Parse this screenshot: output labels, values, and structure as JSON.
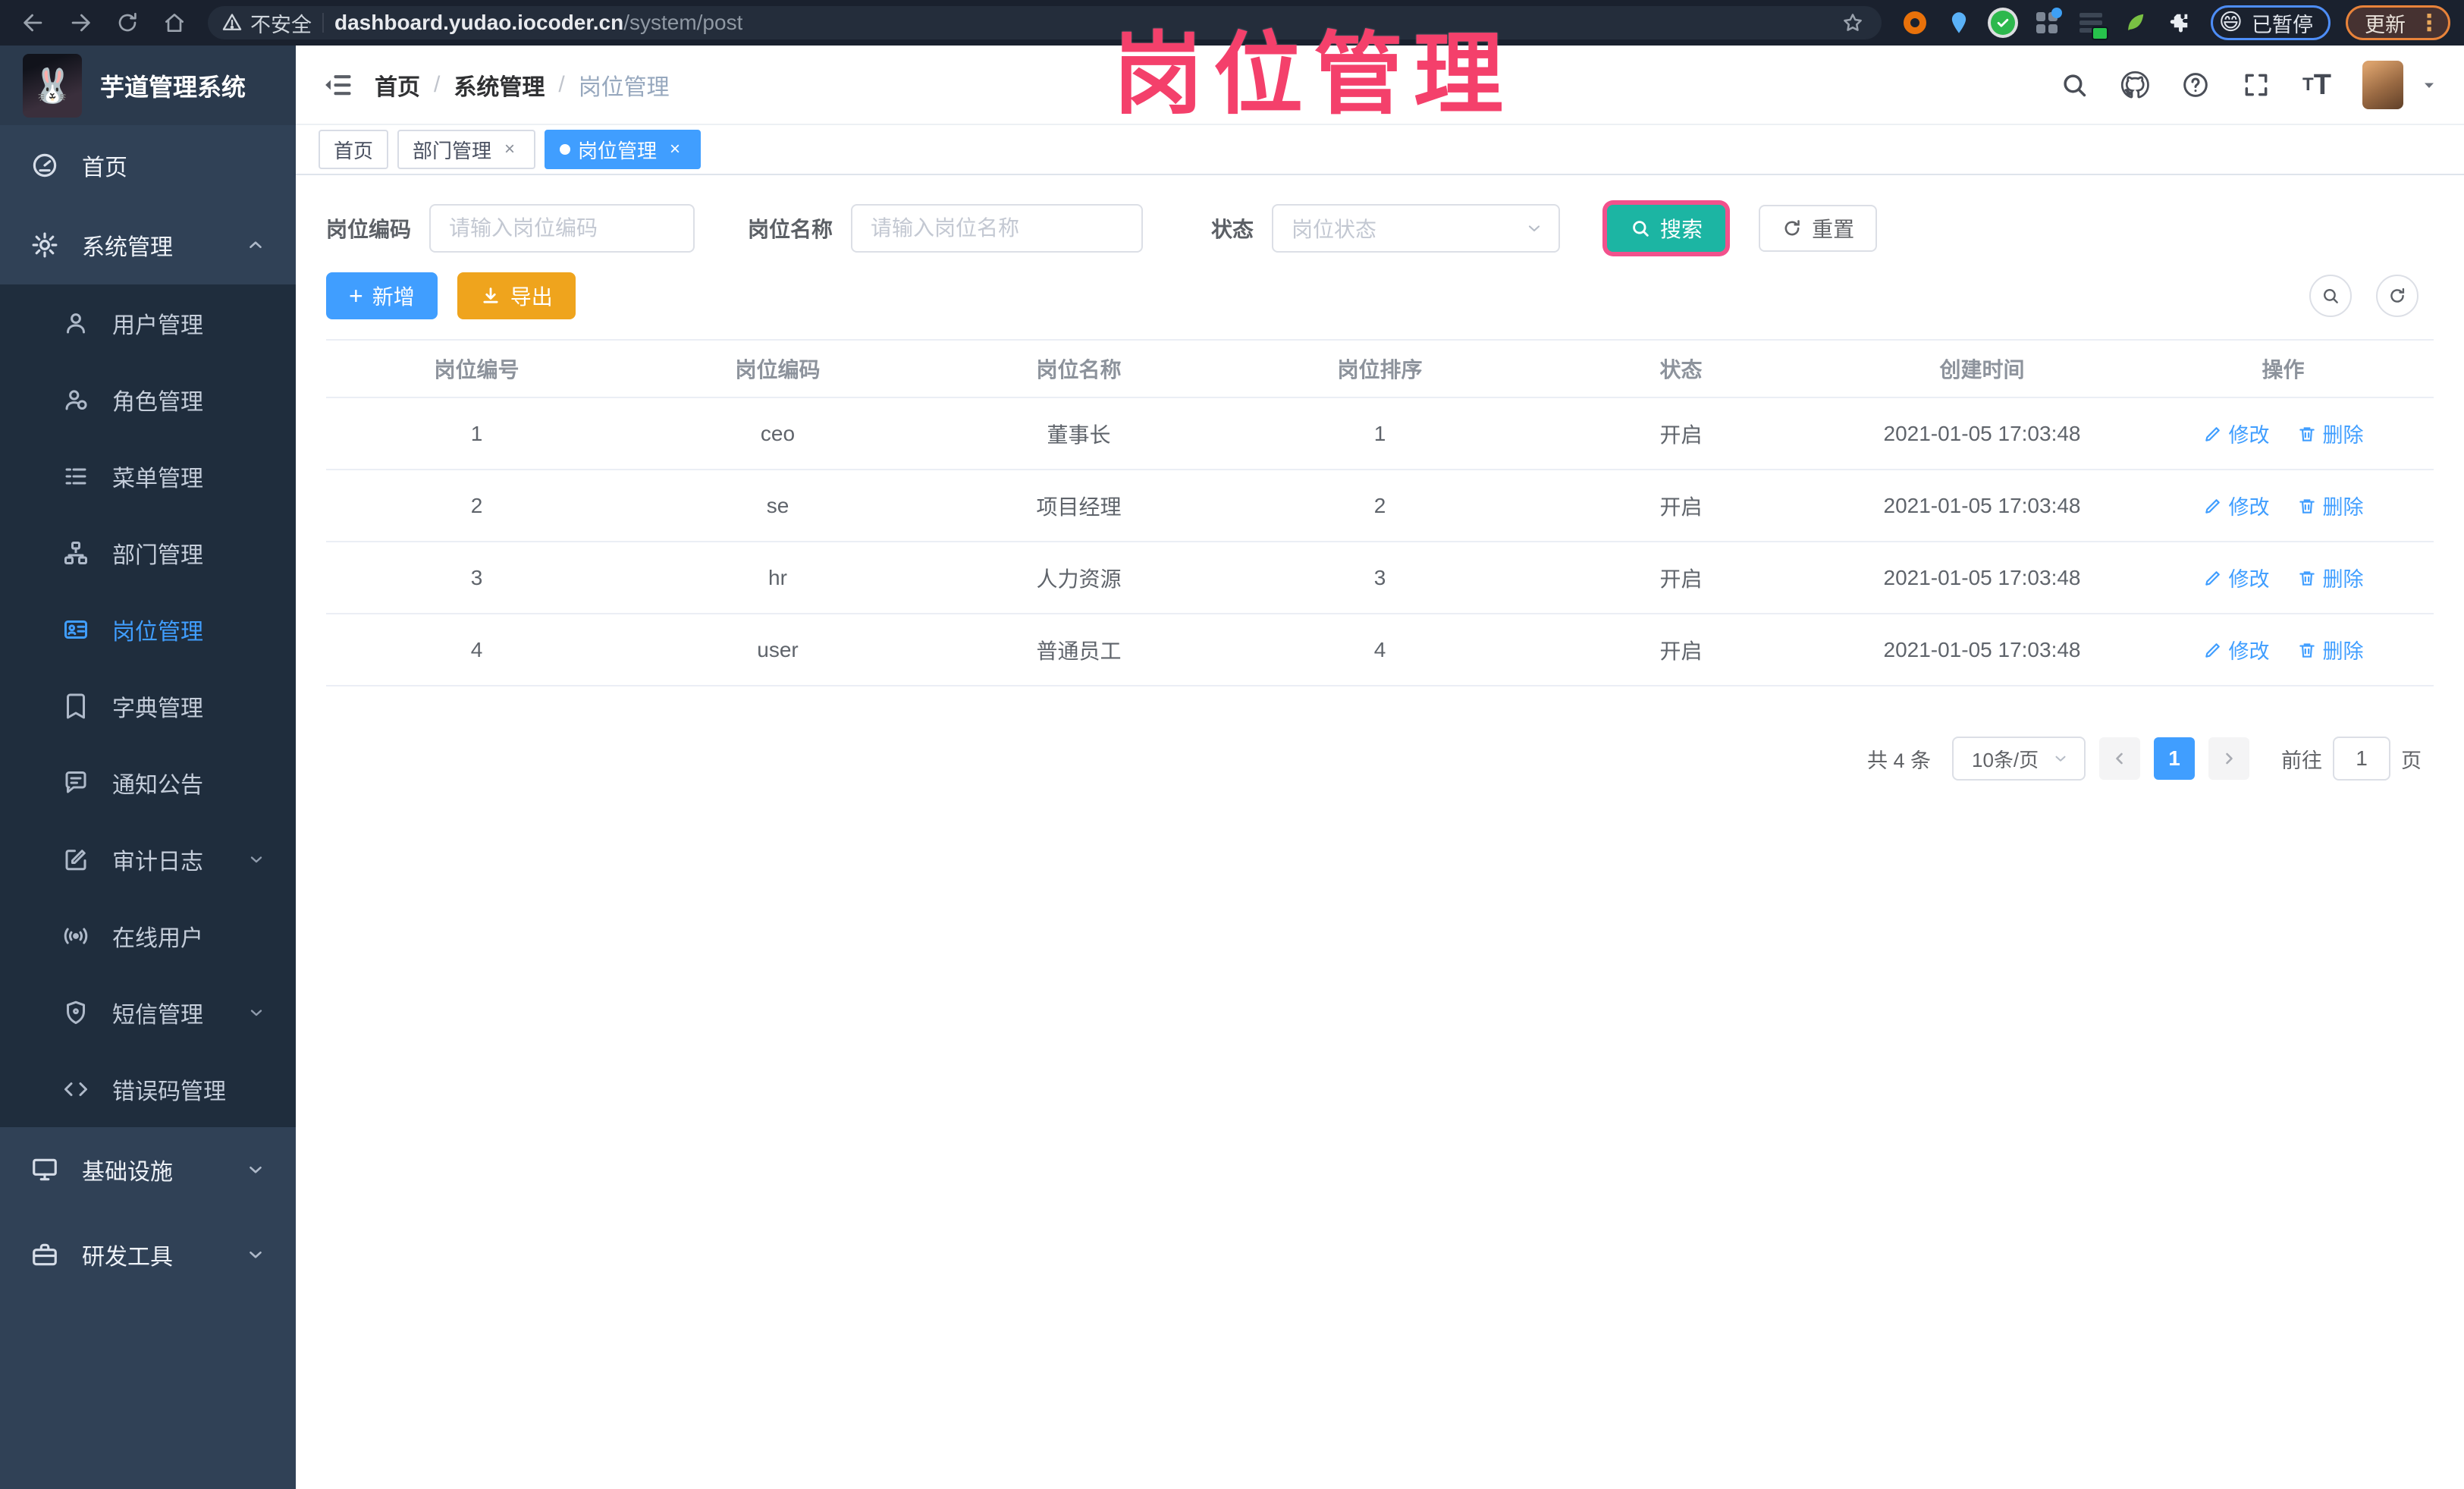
{
  "colors": {
    "accent_blue": "#409eff",
    "search_teal": "#1cb5a3",
    "export_orange": "#efa41d",
    "overlay_pink": "#f4406b",
    "sidebar_bg": "#304156",
    "submenu_bg": "#1f2d3d"
  },
  "overlay_title": "岗位管理",
  "browser": {
    "security_text": "不安全",
    "url_host": "dashboard.yudao.iocoder.cn",
    "url_path": "/system/post",
    "paused_emoji": "😄",
    "paused_label": "已暂停",
    "update_label": "更新",
    "update_menu_dots": "⋮"
  },
  "sidebar": {
    "logo_emoji": "🐰",
    "logo_title": "芋道管理系统",
    "top_items": [
      {
        "label": "首页"
      },
      {
        "label": "系统管理"
      }
    ],
    "system_children": [
      {
        "label": "用户管理"
      },
      {
        "label": "角色管理"
      },
      {
        "label": "菜单管理"
      },
      {
        "label": "部门管理"
      },
      {
        "label": "岗位管理"
      },
      {
        "label": "字典管理"
      },
      {
        "label": "通知公告"
      },
      {
        "label": "审计日志"
      },
      {
        "label": "在线用户"
      },
      {
        "label": "短信管理"
      },
      {
        "label": "错误码管理"
      }
    ],
    "bottom_items": [
      {
        "label": "基础设施"
      },
      {
        "label": "研发工具"
      }
    ]
  },
  "header": {
    "breadcrumb": [
      "首页",
      "系统管理",
      "岗位管理"
    ]
  },
  "tabs": [
    {
      "label": "首页"
    },
    {
      "label": "部门管理"
    },
    {
      "label": "岗位管理"
    }
  ],
  "filter": {
    "code_label": "岗位编码",
    "code_placeholder": "请输入岗位编码",
    "name_label": "岗位名称",
    "name_placeholder": "请输入岗位名称",
    "status_label": "状态",
    "status_placeholder": "岗位状态",
    "search_label": "搜索",
    "reset_label": "重置"
  },
  "toolbar": {
    "add_label": "新增",
    "export_label": "导出"
  },
  "table": {
    "headers": [
      "岗位编号",
      "岗位编码",
      "岗位名称",
      "岗位排序",
      "状态",
      "创建时间",
      "操作"
    ],
    "edit_label": "修改",
    "delete_label": "删除",
    "rows": [
      {
        "id": "1",
        "code": "ceo",
        "name": "董事长",
        "sort": "1",
        "status": "开启",
        "created": "2021-01-05 17:03:48"
      },
      {
        "id": "2",
        "code": "se",
        "name": "项目经理",
        "sort": "2",
        "status": "开启",
        "created": "2021-01-05 17:03:48"
      },
      {
        "id": "3",
        "code": "hr",
        "name": "人力资源",
        "sort": "3",
        "status": "开启",
        "created": "2021-01-05 17:03:48"
      },
      {
        "id": "4",
        "code": "user",
        "name": "普通员工",
        "sort": "4",
        "status": "开启",
        "created": "2021-01-05 17:03:48"
      }
    ]
  },
  "pagination": {
    "total_text": "共 4 条",
    "page_size": "10条/页",
    "current_page": "1",
    "goto_label": "前往",
    "goto_value": "1",
    "page_unit": "页"
  }
}
